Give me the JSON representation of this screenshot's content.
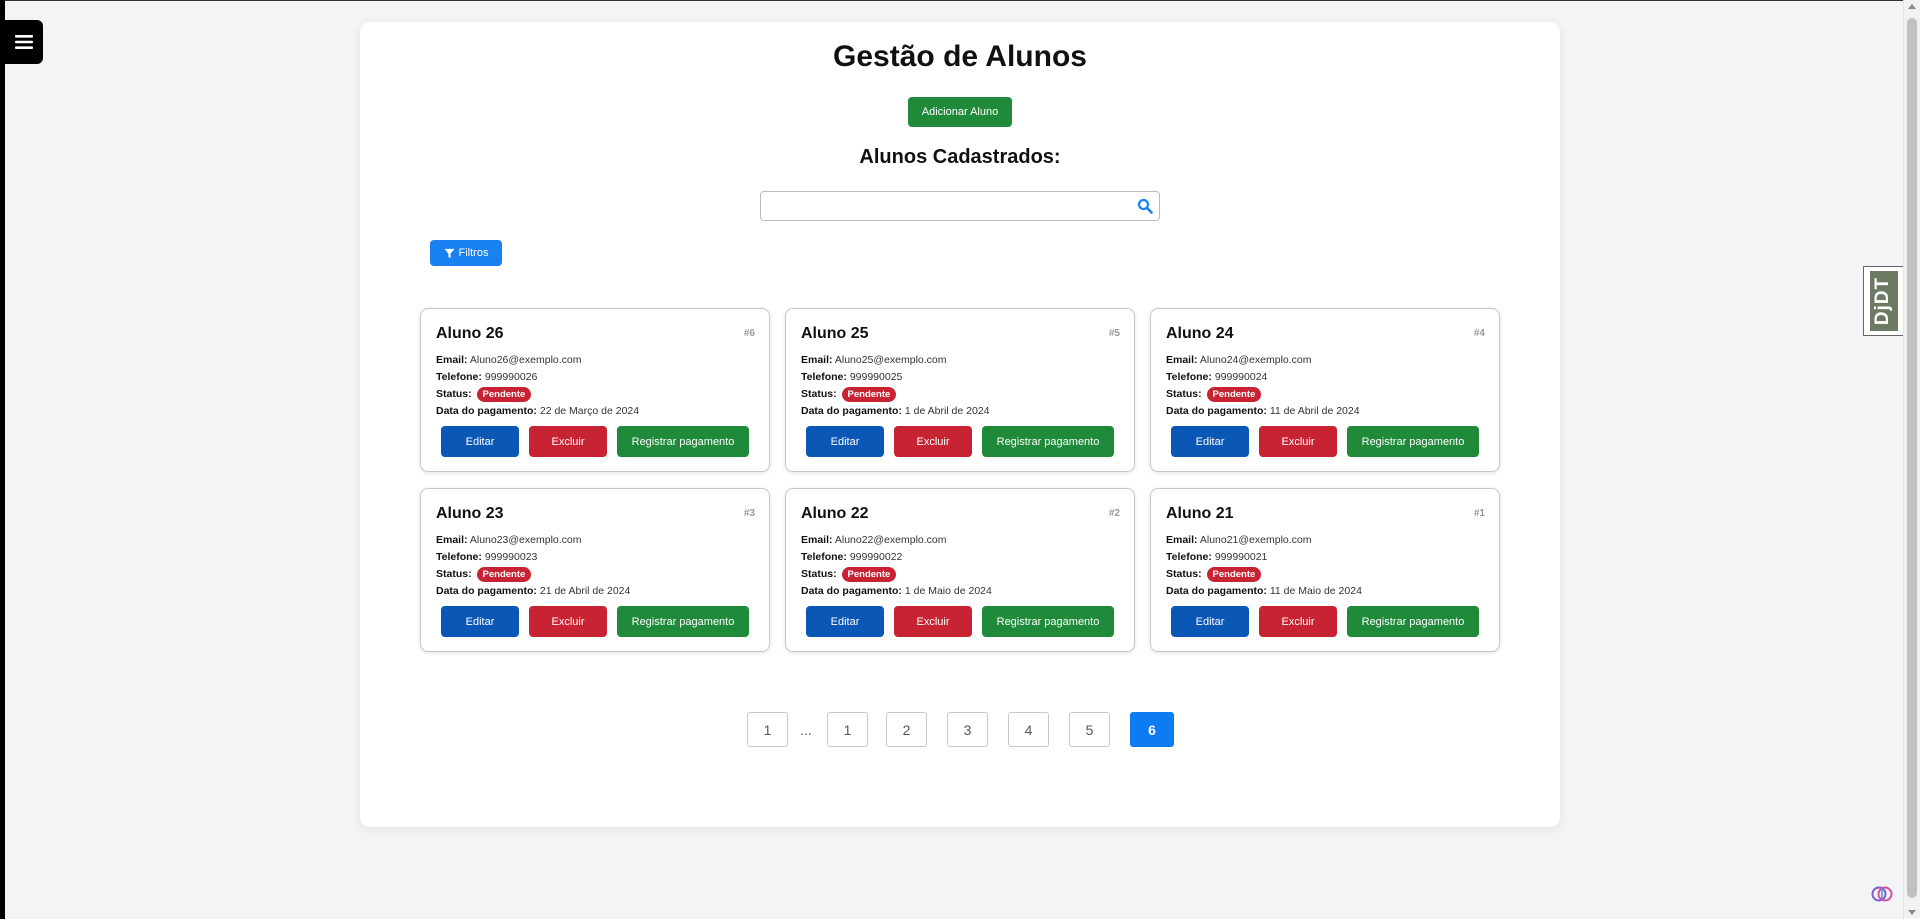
{
  "page": {
    "title": "Gestão de Alunos",
    "add_button": "Adicionar Aluno",
    "subtitle": "Alunos Cadastrados:",
    "search": {
      "value": "",
      "placeholder": ""
    },
    "filter_button": "Filtros",
    "debug_toolbar": "DjDT"
  },
  "labels": {
    "email": "Email:",
    "phone": "Telefone:",
    "status": "Status:",
    "payment_date": "Data do pagamento:"
  },
  "students": [
    {
      "name": "Aluno 26",
      "id": "#6",
      "email": "Aluno26@exemplo.com",
      "phone": "999990026",
      "status": "Pendente",
      "payment_date": "22 de Março de 2024",
      "edit": "Editar",
      "delete": "Excluir",
      "pay": "Registrar pagamento"
    },
    {
      "name": "Aluno 25",
      "id": "#5",
      "email": "Aluno25@exemplo.com",
      "phone": "999990025",
      "status": "Pendente",
      "payment_date": "1 de Abril de 2024",
      "edit": "Editar",
      "delete": "Excluir",
      "pay": "Registrar pagamento"
    },
    {
      "name": "Aluno 24",
      "id": "#4",
      "email": "Aluno24@exemplo.com",
      "phone": "999990024",
      "status": "Pendente",
      "payment_date": "11 de Abril de 2024",
      "edit": "Editar",
      "delete": "Excluir",
      "pay": "Registrar pagamento"
    },
    {
      "name": "Aluno 23",
      "id": "#3",
      "email": "Aluno23@exemplo.com",
      "phone": "999990023",
      "status": "Pendente",
      "payment_date": "21 de Abril de 2024",
      "edit": "Editar",
      "delete": "Excluir",
      "pay": "Registrar pagamento"
    },
    {
      "name": "Aluno 22",
      "id": "#2",
      "email": "Aluno22@exemplo.com",
      "phone": "999990022",
      "status": "Pendente",
      "payment_date": "1 de Maio de 2024",
      "edit": "Editar",
      "delete": "Excluir",
      "pay": "Registrar pagamento"
    },
    {
      "name": "Aluno 21",
      "id": "#1",
      "email": "Aluno21@exemplo.com",
      "phone": "999990021",
      "status": "Pendente",
      "payment_date": "11 de Maio de 2024",
      "edit": "Editar",
      "delete": "Excluir",
      "pay": "Registrar pagamento"
    }
  ],
  "pagination": {
    "first": "1",
    "ellipsis": "...",
    "pages": [
      "1",
      "2",
      "3",
      "4",
      "5",
      "6"
    ],
    "current": "6"
  },
  "colors": {
    "primary": "#1a82f0",
    "success": "#1f8a3a",
    "danger": "#c82333",
    "edit": "#0b57b5"
  },
  "icons": {
    "menu": "hamburger-icon",
    "search": "search-icon",
    "filter": "filter-icon",
    "assistant": "brain-icon"
  }
}
